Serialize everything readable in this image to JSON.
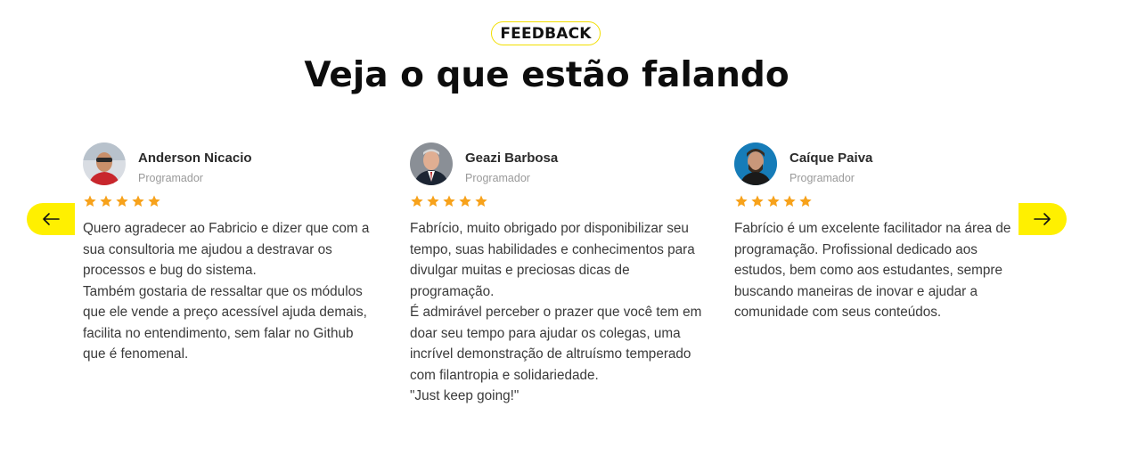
{
  "section": {
    "badge": "FEEDBACK",
    "title": "Veja o que estão falando"
  },
  "colors": {
    "accent": "#fff000",
    "star": "#f7a21b"
  },
  "navigation": {
    "prev_icon": "arrow-left-icon",
    "next_icon": "arrow-right-icon"
  },
  "testimonials": [
    {
      "name": "Anderson Nicacio",
      "role": "Programador",
      "rating": 5,
      "avatar_icon": "avatar-photo",
      "text": "Quero agradecer ao Fabricio e dizer que com a sua consultoria me ajudou a destravar os processos e bug do sistema.\nTambém gostaria de ressaltar que os módulos que ele vende a preço acessível ajuda demais, facilita no entendimento, sem falar no Github que é fenomenal."
    },
    {
      "name": "Geazi Barbosa",
      "role": "Programador",
      "rating": 5,
      "avatar_icon": "avatar-photo",
      "text": "Fabrício, muito obrigado por disponibilizar seu tempo, suas habilidades e conhecimentos para divulgar muitas e preciosas dicas de programação.\nÉ admirável perceber o prazer que você tem em doar seu tempo para ajudar os colegas, uma incrível demonstração de altruísmo temperado com filantropia e solidariedade.\n\"Just keep going!\""
    },
    {
      "name": "Caíque Paiva",
      "role": "Programador",
      "rating": 5,
      "avatar_icon": "avatar-photo",
      "text": "Fabrício é um excelente facilitador na área de programação. Profissional dedicado aos estudos, bem como aos estudantes, sempre buscando maneiras de inovar e ajudar a comunidade com seus conteúdos."
    }
  ]
}
